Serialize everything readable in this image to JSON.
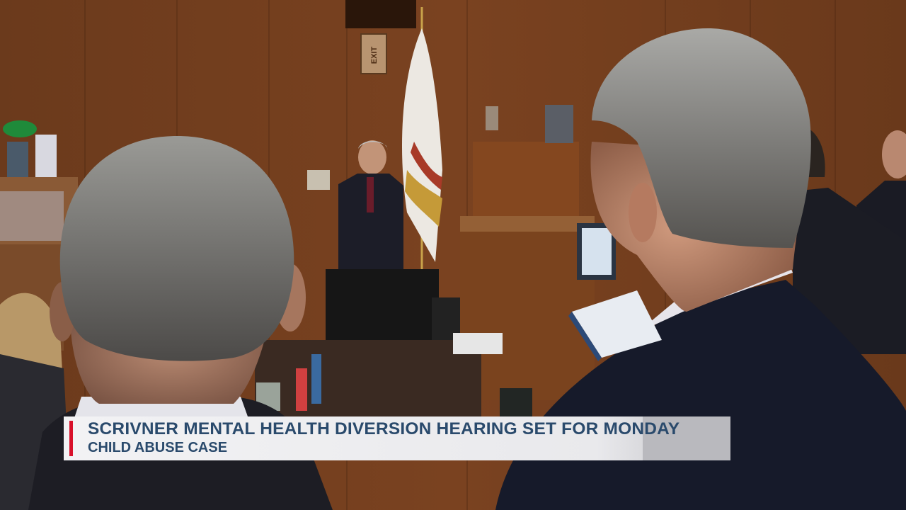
{
  "broadcast": {
    "headline": "SCRIVNER MENTAL HEALTH DIVERSION HEARING SET FOR MONDAY",
    "subheadline": "CHILD ABUSE CASE",
    "accent_color": "#d8102a",
    "text_color": "#2a4a6c"
  },
  "scene": {
    "exit_sign": "EXIT"
  }
}
